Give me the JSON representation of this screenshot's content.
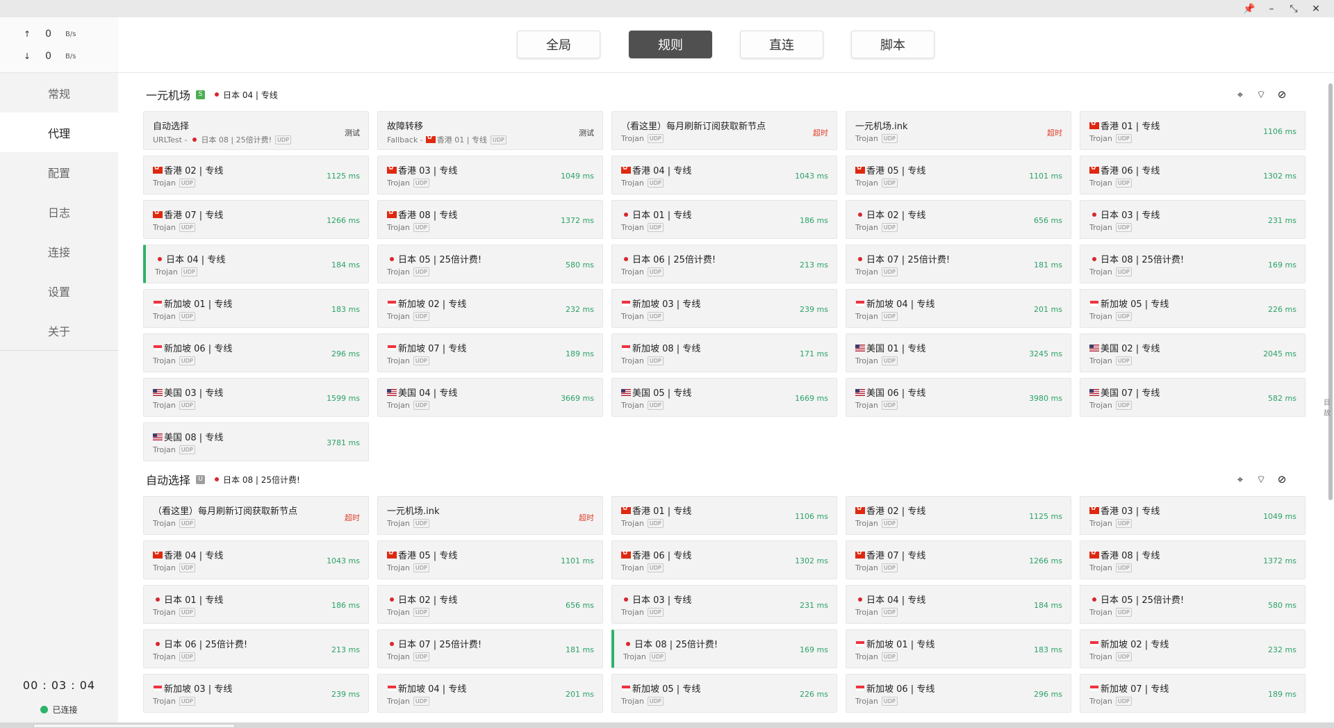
{
  "window": {
    "pin": "📌",
    "minimize": "–",
    "restore": "⤡",
    "close": "✕"
  },
  "traffic": {
    "up_arrow": "↑",
    "up_value": "0",
    "up_unit": "B/s",
    "down_arrow": "↓",
    "down_value": "0",
    "down_unit": "B/s"
  },
  "nav": [
    "常规",
    "代理",
    "配置",
    "日志",
    "连接",
    "设置",
    "关于"
  ],
  "status": {
    "time": "00 : 03 : 04",
    "connected": "已连接"
  },
  "modes": [
    "全局",
    "规则",
    "直连",
    "脚本"
  ],
  "group_tools": {
    "locate": "⌖",
    "test": "⌔",
    "hide": "⊘"
  },
  "side_hint": "目故",
  "colors": {
    "accent": "#2db36b",
    "timeout": "#e0412b",
    "delay": "#2aa266",
    "active_mode": "#505050"
  },
  "groups": [
    {
      "name": "一元机场",
      "badge": "S",
      "badge_color": "#4caf50",
      "selected": "日本 04 | 专线",
      "selected_flag": "jp",
      "items": [
        {
          "flag": "",
          "name": "自动选择",
          "type": "URLTest -",
          "sub_flag": "jp",
          "sub_node": "日本 08 | 25倍计费!",
          "tag": "UDP",
          "delay": "测试",
          "state": "test"
        },
        {
          "flag": "",
          "name": "故障转移",
          "type": "Fallback -",
          "sub_flag": "hk",
          "sub_node": "香港 01 | 专线",
          "tag": "UDP",
          "delay": "测试",
          "state": "test"
        },
        {
          "flag": "",
          "name": "（看这里）每月刷新订阅获取新节点",
          "type": "Trojan",
          "tag": "UDP",
          "delay": "超时",
          "state": "timeout"
        },
        {
          "flag": "",
          "name": "一元机场.ink",
          "type": "Trojan",
          "tag": "UDP",
          "delay": "超时",
          "state": "timeout"
        },
        {
          "flag": "hk",
          "name": "香港 01 | 专线",
          "type": "Trojan",
          "tag": "UDP",
          "delay": "1106 ms",
          "state": "ok"
        },
        {
          "flag": "hk",
          "name": "香港 02 | 专线",
          "type": "Trojan",
          "tag": "UDP",
          "delay": "1125 ms",
          "state": "ok"
        },
        {
          "flag": "hk",
          "name": "香港 03 | 专线",
          "type": "Trojan",
          "tag": "UDP",
          "delay": "1049 ms",
          "state": "ok"
        },
        {
          "flag": "hk",
          "name": "香港 04 | 专线",
          "type": "Trojan",
          "tag": "UDP",
          "delay": "1043 ms",
          "state": "ok"
        },
        {
          "flag": "hk",
          "name": "香港 05 | 专线",
          "type": "Trojan",
          "tag": "UDP",
          "delay": "1101 ms",
          "state": "ok"
        },
        {
          "flag": "hk",
          "name": "香港 06 | 专线",
          "type": "Trojan",
          "tag": "UDP",
          "delay": "1302 ms",
          "state": "ok"
        },
        {
          "flag": "hk",
          "name": "香港 07 | 专线",
          "type": "Trojan",
          "tag": "UDP",
          "delay": "1266 ms",
          "state": "ok"
        },
        {
          "flag": "hk",
          "name": "香港 08 | 专线",
          "type": "Trojan",
          "tag": "UDP",
          "delay": "1372 ms",
          "state": "ok"
        },
        {
          "flag": "jp",
          "name": "日本 01 | 专线",
          "type": "Trojan",
          "tag": "UDP",
          "delay": "186 ms",
          "state": "ok"
        },
        {
          "flag": "jp",
          "name": "日本 02 | 专线",
          "type": "Trojan",
          "tag": "UDP",
          "delay": "656 ms",
          "state": "ok"
        },
        {
          "flag": "jp",
          "name": "日本 03 | 专线",
          "type": "Trojan",
          "tag": "UDP",
          "delay": "231 ms",
          "state": "ok"
        },
        {
          "flag": "jp",
          "name": "日本 04 | 专线",
          "type": "Trojan",
          "tag": "UDP",
          "delay": "184 ms",
          "state": "ok",
          "selected": true
        },
        {
          "flag": "jp",
          "name": "日本 05 | 25倍计费!",
          "type": "Trojan",
          "tag": "UDP",
          "delay": "580 ms",
          "state": "ok"
        },
        {
          "flag": "jp",
          "name": "日本 06 | 25倍计费!",
          "type": "Trojan",
          "tag": "UDP",
          "delay": "213 ms",
          "state": "ok"
        },
        {
          "flag": "jp",
          "name": "日本 07 | 25倍计费!",
          "type": "Trojan",
          "tag": "UDP",
          "delay": "181 ms",
          "state": "ok"
        },
        {
          "flag": "jp",
          "name": "日本 08 | 25倍计费!",
          "type": "Trojan",
          "tag": "UDP",
          "delay": "169 ms",
          "state": "ok"
        },
        {
          "flag": "sg",
          "name": "新加坡 01 | 专线",
          "type": "Trojan",
          "tag": "UDP",
          "delay": "183 ms",
          "state": "ok"
        },
        {
          "flag": "sg",
          "name": "新加坡 02 | 专线",
          "type": "Trojan",
          "tag": "UDP",
          "delay": "232 ms",
          "state": "ok"
        },
        {
          "flag": "sg",
          "name": "新加坡 03 | 专线",
          "type": "Trojan",
          "tag": "UDP",
          "delay": "239 ms",
          "state": "ok"
        },
        {
          "flag": "sg",
          "name": "新加坡 04 | 专线",
          "type": "Trojan",
          "tag": "UDP",
          "delay": "201 ms",
          "state": "ok"
        },
        {
          "flag": "sg",
          "name": "新加坡 05 | 专线",
          "type": "Trojan",
          "tag": "UDP",
          "delay": "226 ms",
          "state": "ok"
        },
        {
          "flag": "sg",
          "name": "新加坡 06 | 专线",
          "type": "Trojan",
          "tag": "UDP",
          "delay": "296 ms",
          "state": "ok"
        },
        {
          "flag": "sg",
          "name": "新加坡 07 | 专线",
          "type": "Trojan",
          "tag": "UDP",
          "delay": "189 ms",
          "state": "ok"
        },
        {
          "flag": "sg",
          "name": "新加坡 08 | 专线",
          "type": "Trojan",
          "tag": "UDP",
          "delay": "171 ms",
          "state": "ok"
        },
        {
          "flag": "us",
          "name": "美国 01 | 专线",
          "type": "Trojan",
          "tag": "UDP",
          "delay": "3245 ms",
          "state": "ok"
        },
        {
          "flag": "us",
          "name": "美国 02 | 专线",
          "type": "Trojan",
          "tag": "UDP",
          "delay": "2045 ms",
          "state": "ok"
        },
        {
          "flag": "us",
          "name": "美国 03 | 专线",
          "type": "Trojan",
          "tag": "UDP",
          "delay": "1599 ms",
          "state": "ok"
        },
        {
          "flag": "us",
          "name": "美国 04 | 专线",
          "type": "Trojan",
          "tag": "UDP",
          "delay": "3669 ms",
          "state": "ok"
        },
        {
          "flag": "us",
          "name": "美国 05 | 专线",
          "type": "Trojan",
          "tag": "UDP",
          "delay": "1669 ms",
          "state": "ok"
        },
        {
          "flag": "us",
          "name": "美国 06 | 专线",
          "type": "Trojan",
          "tag": "UDP",
          "delay": "3980 ms",
          "state": "ok"
        },
        {
          "flag": "us",
          "name": "美国 07 | 专线",
          "type": "Trojan",
          "tag": "UDP",
          "delay": "582 ms",
          "state": "ok"
        },
        {
          "flag": "us",
          "name": "美国 08 | 专线",
          "type": "Trojan",
          "tag": "UDP",
          "delay": "3781 ms",
          "state": "ok"
        }
      ]
    },
    {
      "name": "自动选择",
      "badge": "U",
      "badge_color": "#9e9e9e",
      "selected": "日本 08 | 25倍计费!",
      "selected_flag": "jp",
      "items": [
        {
          "flag": "",
          "name": "（看这里）每月刷新订阅获取新节点",
          "type": "Trojan",
          "tag": "UDP",
          "delay": "超时",
          "state": "timeout"
        },
        {
          "flag": "",
          "name": "一元机场.ink",
          "type": "Trojan",
          "tag": "UDP",
          "delay": "超时",
          "state": "timeout"
        },
        {
          "flag": "hk",
          "name": "香港 01 | 专线",
          "type": "Trojan",
          "tag": "UDP",
          "delay": "1106 ms",
          "state": "ok"
        },
        {
          "flag": "hk",
          "name": "香港 02 | 专线",
          "type": "Trojan",
          "tag": "UDP",
          "delay": "1125 ms",
          "state": "ok"
        },
        {
          "flag": "hk",
          "name": "香港 03 | 专线",
          "type": "Trojan",
          "tag": "UDP",
          "delay": "1049 ms",
          "state": "ok"
        },
        {
          "flag": "hk",
          "name": "香港 04 | 专线",
          "type": "Trojan",
          "tag": "UDP",
          "delay": "1043 ms",
          "state": "ok"
        },
        {
          "flag": "hk",
          "name": "香港 05 | 专线",
          "type": "Trojan",
          "tag": "UDP",
          "delay": "1101 ms",
          "state": "ok"
        },
        {
          "flag": "hk",
          "name": "香港 06 | 专线",
          "type": "Trojan",
          "tag": "UDP",
          "delay": "1302 ms",
          "state": "ok"
        },
        {
          "flag": "hk",
          "name": "香港 07 | 专线",
          "type": "Trojan",
          "tag": "UDP",
          "delay": "1266 ms",
          "state": "ok"
        },
        {
          "flag": "hk",
          "name": "香港 08 | 专线",
          "type": "Trojan",
          "tag": "UDP",
          "delay": "1372 ms",
          "state": "ok"
        },
        {
          "flag": "jp",
          "name": "日本 01 | 专线",
          "type": "Trojan",
          "tag": "UDP",
          "delay": "186 ms",
          "state": "ok"
        },
        {
          "flag": "jp",
          "name": "日本 02 | 专线",
          "type": "Trojan",
          "tag": "UDP",
          "delay": "656 ms",
          "state": "ok"
        },
        {
          "flag": "jp",
          "name": "日本 03 | 专线",
          "type": "Trojan",
          "tag": "UDP",
          "delay": "231 ms",
          "state": "ok"
        },
        {
          "flag": "jp",
          "name": "日本 04 | 专线",
          "type": "Trojan",
          "tag": "UDP",
          "delay": "184 ms",
          "state": "ok"
        },
        {
          "flag": "jp",
          "name": "日本 05 | 25倍计费!",
          "type": "Trojan",
          "tag": "UDP",
          "delay": "580 ms",
          "state": "ok"
        },
        {
          "flag": "jp",
          "name": "日本 06 | 25倍计费!",
          "type": "Trojan",
          "tag": "UDP",
          "delay": "213 ms",
          "state": "ok"
        },
        {
          "flag": "jp",
          "name": "日本 07 | 25倍计费!",
          "type": "Trojan",
          "tag": "UDP",
          "delay": "181 ms",
          "state": "ok"
        },
        {
          "flag": "jp",
          "name": "日本 08 | 25倍计费!",
          "type": "Trojan",
          "tag": "UDP",
          "delay": "169 ms",
          "state": "ok",
          "selected": true
        },
        {
          "flag": "sg",
          "name": "新加坡 01 | 专线",
          "type": "Trojan",
          "tag": "UDP",
          "delay": "183 ms",
          "state": "ok"
        },
        {
          "flag": "sg",
          "name": "新加坡 02 | 专线",
          "type": "Trojan",
          "tag": "UDP",
          "delay": "232 ms",
          "state": "ok"
        },
        {
          "flag": "sg",
          "name": "新加坡 03 | 专线",
          "type": "Trojan",
          "tag": "UDP",
          "delay": "239 ms",
          "state": "ok"
        },
        {
          "flag": "sg",
          "name": "新加坡 04 | 专线",
          "type": "Trojan",
          "tag": "UDP",
          "delay": "201 ms",
          "state": "ok"
        },
        {
          "flag": "sg",
          "name": "新加坡 05 | 专线",
          "type": "Trojan",
          "tag": "UDP",
          "delay": "226 ms",
          "state": "ok"
        },
        {
          "flag": "sg",
          "name": "新加坡 06 | 专线",
          "type": "Trojan",
          "tag": "UDP",
          "delay": "296 ms",
          "state": "ok"
        },
        {
          "flag": "sg",
          "name": "新加坡 07 | 专线",
          "type": "Trojan",
          "tag": "UDP",
          "delay": "189 ms",
          "state": "ok"
        }
      ]
    }
  ]
}
